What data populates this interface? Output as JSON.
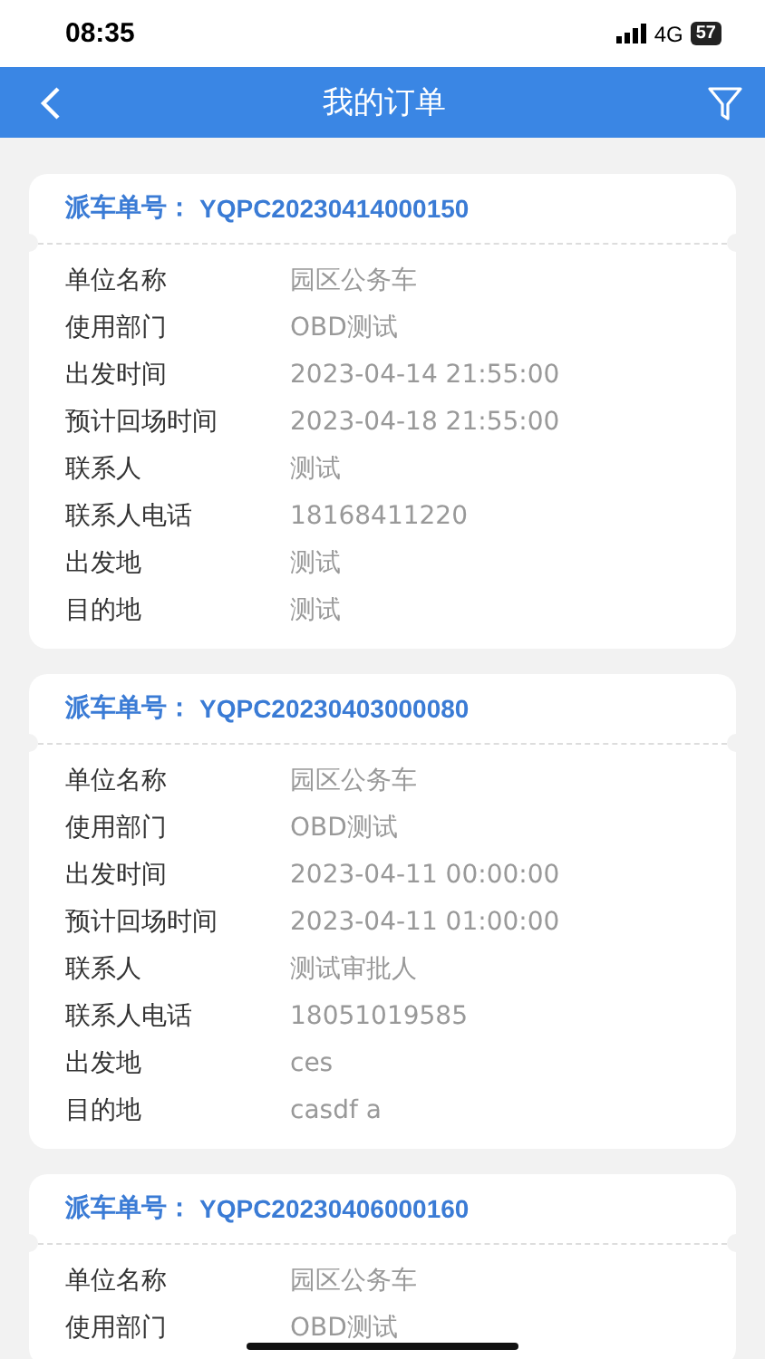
{
  "status_bar": {
    "time": "08:35",
    "network": "4G",
    "battery": "57"
  },
  "nav": {
    "title": "我的订单"
  },
  "orders": [
    {
      "label": "派车单号：",
      "number": "YQPC20230414000150",
      "fields": [
        {
          "label": "单位名称",
          "value": "园区公务车"
        },
        {
          "label": "使用部门",
          "value": "OBD测试"
        },
        {
          "label": "出发时间",
          "value": "2023-04-14 21:55:00"
        },
        {
          "label": "预计回场时间",
          "value": "2023-04-18 21:55:00"
        },
        {
          "label": "联系人",
          "value": "测试"
        },
        {
          "label": "联系人电话",
          "value": "18168411220"
        },
        {
          "label": "出发地",
          "value": "测试"
        },
        {
          "label": "目的地",
          "value": "测试"
        }
      ]
    },
    {
      "label": "派车单号：",
      "number": "YQPC20230403000080",
      "fields": [
        {
          "label": "单位名称",
          "value": "园区公务车"
        },
        {
          "label": "使用部门",
          "value": "OBD测试"
        },
        {
          "label": "出发时间",
          "value": "2023-04-11 00:00:00"
        },
        {
          "label": "预计回场时间",
          "value": "2023-04-11 01:00:00"
        },
        {
          "label": "联系人",
          "value": "测试审批人"
        },
        {
          "label": "联系人电话",
          "value": "18051019585"
        },
        {
          "label": "出发地",
          "value": "ces"
        },
        {
          "label": "目的地",
          "value": "casdf a"
        }
      ]
    },
    {
      "label": "派车单号：",
      "number": "YQPC20230406000160",
      "fields": [
        {
          "label": "单位名称",
          "value": "园区公务车"
        },
        {
          "label": "使用部门",
          "value": "OBD测试"
        }
      ]
    }
  ]
}
